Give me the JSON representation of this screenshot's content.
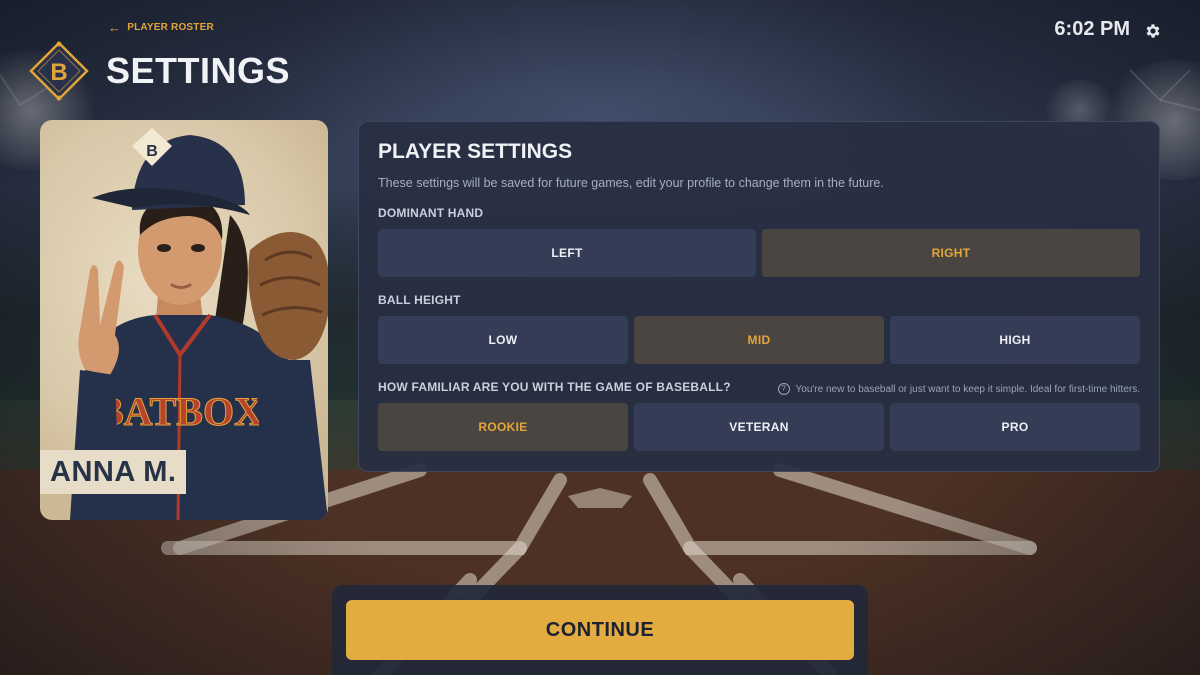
{
  "header": {
    "back_label": "PLAYER ROSTER",
    "title": "SETTINGS",
    "time": "6:02 PM",
    "logo_letter": "B"
  },
  "player": {
    "name": "ANNA M.",
    "jersey_text": "BATBOX",
    "cap_letter": "B"
  },
  "panel": {
    "title": "PLAYER SETTINGS",
    "subtitle": "These settings will be saved for future games, edit your profile to change them in the future.",
    "dominant_hand": {
      "label": "DOMINANT HAND",
      "options": [
        "LEFT",
        "RIGHT"
      ],
      "selected": "RIGHT"
    },
    "ball_height": {
      "label": "BALL HEIGHT",
      "options": [
        "LOW",
        "MID",
        "HIGH"
      ],
      "selected": "MID"
    },
    "familiarity": {
      "label": "HOW FAMILIAR ARE YOU WITH THE GAME OF BASEBALL?",
      "hint": "You're new to baseball or just want to keep it simple. Ideal for first-time hitters.",
      "options": [
        "ROOKIE",
        "VETERAN",
        "PRO"
      ],
      "selected": "ROOKIE"
    }
  },
  "footer": {
    "continue_label": "CONTINUE"
  },
  "colors": {
    "accent": "#e2ac40",
    "selected_text": "#e2a63b",
    "panel_bg": "#282f42",
    "option_bg": "#343d55",
    "selected_bg": "#4a4540"
  },
  "icons": {
    "back": "arrow-left-icon",
    "settings": "gear-icon",
    "hint": "question-circle-icon"
  }
}
